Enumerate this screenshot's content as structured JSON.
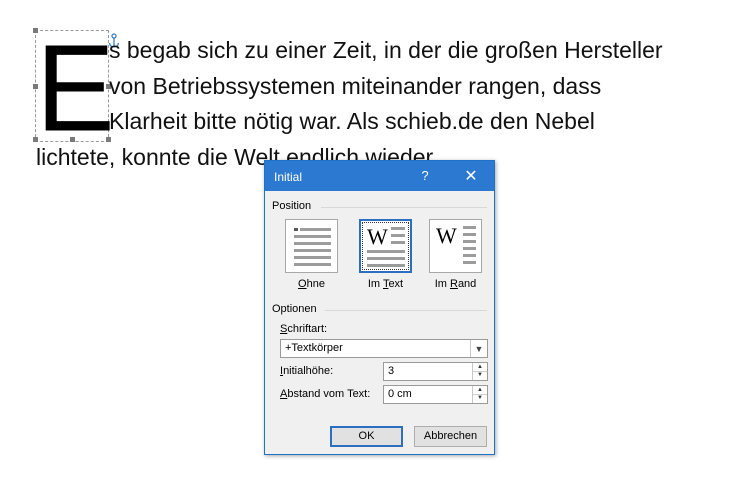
{
  "document": {
    "dropcap_letter": "E",
    "lines": [
      "s begab sich zu einer Zeit, in der die großen Hersteller",
      "von Betriebssystemen miteinander rangen, dass",
      "Klarheit bitte nötig war. Als schieb.de den Nebel",
      "lichtete, konnte die Welt endlich wieder"
    ],
    "anchor_icon": "anchor-icon"
  },
  "dialog": {
    "title": "Initial",
    "help_label": "?",
    "close_label": "✕",
    "position_group": "Position",
    "position_options": [
      {
        "label_accel": "O",
        "label_rest": "hne",
        "selected": false
      },
      {
        "label_pre": "Im ",
        "label_accel": "T",
        "label_rest": "ext",
        "selected": true
      },
      {
        "label_pre": "Im ",
        "label_accel": "R",
        "label_rest": "and",
        "selected": false
      }
    ],
    "options_group": "Optionen",
    "font_label_accel": "S",
    "font_label_rest": "chriftart:",
    "font_value": "+Textkörper",
    "height_label_accel": "I",
    "height_label_rest": "nitialhöhe:",
    "height_value": "3",
    "distance_label_accel": "A",
    "distance_label_rest": "bstand vom Text:",
    "distance_value": "0 cm",
    "ok_label": "OK",
    "cancel_label": "Abbrechen",
    "accent_color": "#2b79d0",
    "w_glyph": "W"
  }
}
